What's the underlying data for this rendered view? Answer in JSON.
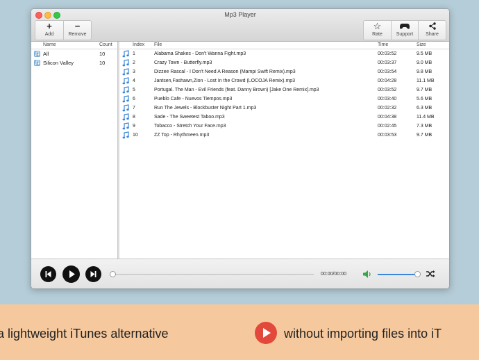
{
  "window": {
    "title": "Mp3 Player"
  },
  "toolbar": {
    "add_label": "Add",
    "remove_label": "Remove",
    "rate_label": "Rate",
    "support_label": "Support",
    "share_label": "Share"
  },
  "sidebar": {
    "headers": {
      "name": "Name",
      "count": "Count"
    },
    "items": [
      {
        "name": "All",
        "count": "10"
      },
      {
        "name": "Silicon Valley",
        "count": "10"
      }
    ]
  },
  "tracks": {
    "headers": {
      "index": "Index",
      "file": "File",
      "time": "Time",
      "size": "Size"
    },
    "rows": [
      {
        "index": "1",
        "file": "Alabama Shakes - Don't Wanna Fight.mp3",
        "time": "00:03:52",
        "size": "9.5 MB"
      },
      {
        "index": "2",
        "file": "Crazy Town - Butterfly.mp3",
        "time": "00:03:37",
        "size": "9.0 MB"
      },
      {
        "index": "3",
        "file": "Dizzee Rascal - I Don't Need A Reason (Mampi Swift Remix).mp3",
        "time": "00:03:54",
        "size": "9.8 MB"
      },
      {
        "index": "4",
        "file": "Jantsen,Fashawn,Zion - Lost In the Crowd (LOCOJA Remix).mp3",
        "time": "00:04:28",
        "size": "11.1 MB"
      },
      {
        "index": "5",
        "file": "Portugal. The Man - Evil Friends (feat. Danny Brown) [Jake One Remix].mp3",
        "time": "00:03:52",
        "size": "9.7 MB"
      },
      {
        "index": "6",
        "file": "Pueblo Cafe - Nuevos Tiempos.mp3",
        "time": "00:03:40",
        "size": "5.6 MB"
      },
      {
        "index": "7",
        "file": "Run The Jewels - Blockbuster Night Part 1.mp3",
        "time": "00:02:32",
        "size": "6.3 MB"
      },
      {
        "index": "8",
        "file": "Sade - The Sweetest Taboo.mp3",
        "time": "00:04:38",
        "size": "11.4 MB"
      },
      {
        "index": "9",
        "file": "Tobacco - Stretch Your Face.mp3",
        "time": "00:02:45",
        "size": "7.3 MB"
      },
      {
        "index": "10",
        "file": "ZZ Top - Rhythmeen.mp3",
        "time": "00:03:53",
        "size": "9.7 MB"
      }
    ]
  },
  "player": {
    "time_readout": "00:00/00:00",
    "progress_fraction": 0,
    "volume_fraction": 1
  },
  "banner": {
    "left_text": "a lightweight iTunes alternative",
    "right_text": "without importing files into iT"
  },
  "colors": {
    "accent_blue": "#3a86d8",
    "volume_green": "#3aa54a",
    "banner_bg": "#f6c89d",
    "banner_icon_red": "#e2493b"
  }
}
